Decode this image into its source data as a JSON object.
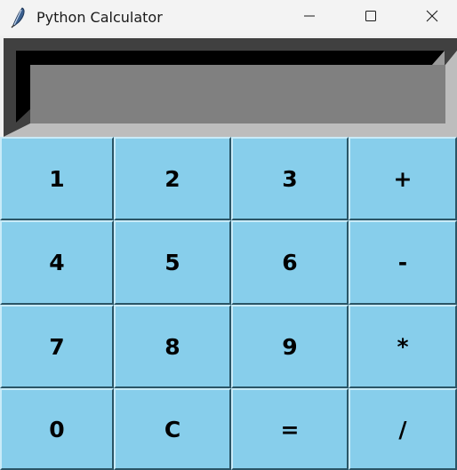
{
  "window": {
    "title": "Python Calculator",
    "icon": "feather-icon",
    "controls": [
      "minimize-icon",
      "maximize-icon",
      "close-icon"
    ]
  },
  "display": {
    "value": ""
  },
  "keys": [
    [
      "1",
      "2",
      "3",
      "+"
    ],
    [
      "4",
      "5",
      "6",
      "-"
    ],
    [
      "7",
      "8",
      "9",
      "*"
    ],
    [
      "0",
      "C",
      "=",
      "/"
    ]
  ],
  "colors": {
    "key_background": "#87ceeb",
    "display_background": "#808080"
  }
}
